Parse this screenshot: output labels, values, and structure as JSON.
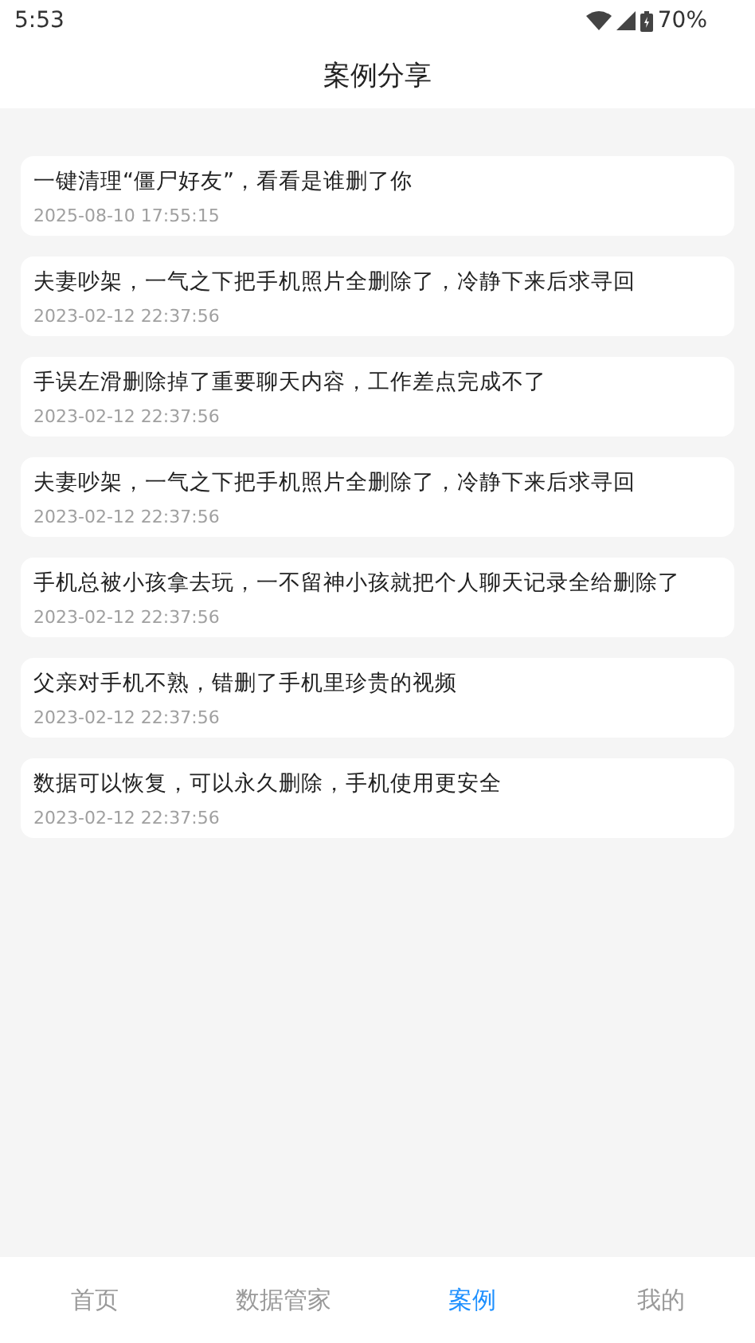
{
  "status_bar": {
    "time": "5:53",
    "battery": "70%"
  },
  "header": {
    "title": "案例分享"
  },
  "cases": [
    {
      "title": "一键清理“僵尸好友”，看看是谁删了你",
      "date": "2025-08-10 17:55:15"
    },
    {
      "title": "夫妻吵架，一气之下把手机照片全删除了，冷静下来后求寻回",
      "date": "2023-02-12 22:37:56"
    },
    {
      "title": "手误左滑删除掉了重要聊天内容，工作差点完成不了",
      "date": "2023-02-12 22:37:56"
    },
    {
      "title": "夫妻吵架，一气之下把手机照片全删除了，冷静下来后求寻回",
      "date": "2023-02-12 22:37:56"
    },
    {
      "title": "手机总被小孩拿去玩，一不留神小孩就把个人聊天记录全给删除了",
      "date": "2023-02-12 22:37:56"
    },
    {
      "title": "父亲对手机不熟，错删了手机里珍贵的视频",
      "date": "2023-02-12 22:37:56"
    },
    {
      "title": "数据可以恢复，可以永久删除，手机使用更安全",
      "date": "2023-02-12 22:37:56"
    }
  ],
  "bottom_nav": [
    {
      "label": "首页",
      "selected": false
    },
    {
      "label": "数据管家",
      "selected": false
    },
    {
      "label": "案例",
      "selected": true
    },
    {
      "label": "我的",
      "selected": false
    }
  ]
}
